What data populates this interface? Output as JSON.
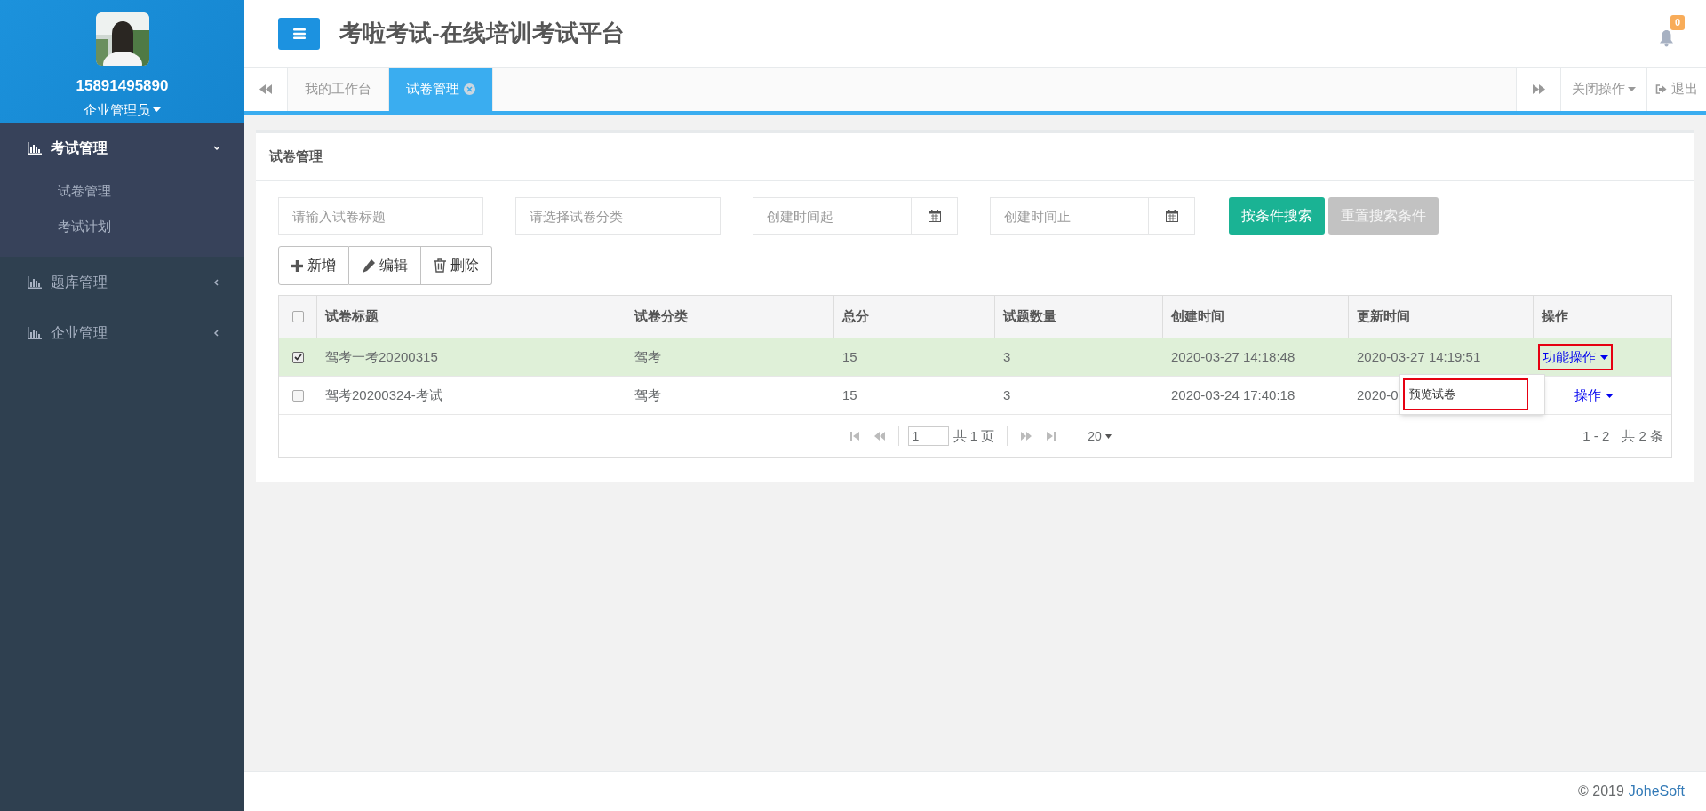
{
  "sidebar": {
    "user": {
      "name": "15891495890",
      "role": "企业管理员"
    },
    "menu": [
      {
        "label": "考试管理",
        "expanded": true,
        "children": [
          {
            "label": "试卷管理"
          },
          {
            "label": "考试计划"
          }
        ]
      },
      {
        "label": "题库管理",
        "expanded": false
      },
      {
        "label": "企业管理",
        "expanded": false
      }
    ]
  },
  "header": {
    "title": "考啦考试-在线培训考试平台",
    "notification_count": "0"
  },
  "tabs": [
    {
      "label": "我的工作台",
      "selected": false,
      "closable": false
    },
    {
      "label": "试卷管理",
      "selected": true,
      "closable": true
    }
  ],
  "tab_actions": {
    "close_menu": "关闭操作",
    "logout": "退出"
  },
  "panel": {
    "title": "试卷管理",
    "filters": [
      {
        "placeholder": "请输入试卷标题",
        "kind": "text"
      },
      {
        "placeholder": "请选择试卷分类",
        "kind": "text"
      },
      {
        "placeholder": "创建时间起",
        "kind": "date"
      },
      {
        "placeholder": "创建时间止",
        "kind": "date"
      }
    ],
    "search_buttons": [
      {
        "label": "按条件搜索",
        "kind": "primary"
      },
      {
        "label": "重置搜索条件",
        "kind": "secondary"
      }
    ],
    "toolbar": [
      {
        "label": "新增",
        "kind": "add"
      },
      {
        "label": "编辑",
        "kind": "edit"
      },
      {
        "label": "删除",
        "kind": "delete"
      }
    ],
    "table": {
      "select_all": false,
      "columns": [
        "试卷标题",
        "试卷分类",
        "总分",
        "试题数量",
        "创建时间",
        "更新时间",
        "操作"
      ],
      "rows": [
        {
          "checked": true,
          "selected": true,
          "cells": [
            "驾考一考20200315",
            "驾考",
            "15",
            "3",
            "2020-03-27 14:18:48",
            "2020-03-27 14:19:51"
          ],
          "action": {
            "label": "功能操作",
            "highlighted": true
          },
          "menu_open": true,
          "menu": [
            {
              "label": "预览试卷",
              "highlighted": true
            }
          ]
        },
        {
          "checked": false,
          "selected": false,
          "cells": [
            "驾考20200324-考试",
            "驾考",
            "15",
            "3",
            "2020-03-24 17:40:18",
            "2020-0"
          ],
          "action": {
            "label": "操作",
            "highlighted": false
          }
        }
      ]
    },
    "pagination": {
      "page": "1",
      "total_pages": "共 1 页",
      "page_size": "20",
      "range": "1 - 2",
      "total": "共 2 条"
    }
  },
  "footer": {
    "copyright": "© 2019",
    "brand": "JoheSoft"
  }
}
